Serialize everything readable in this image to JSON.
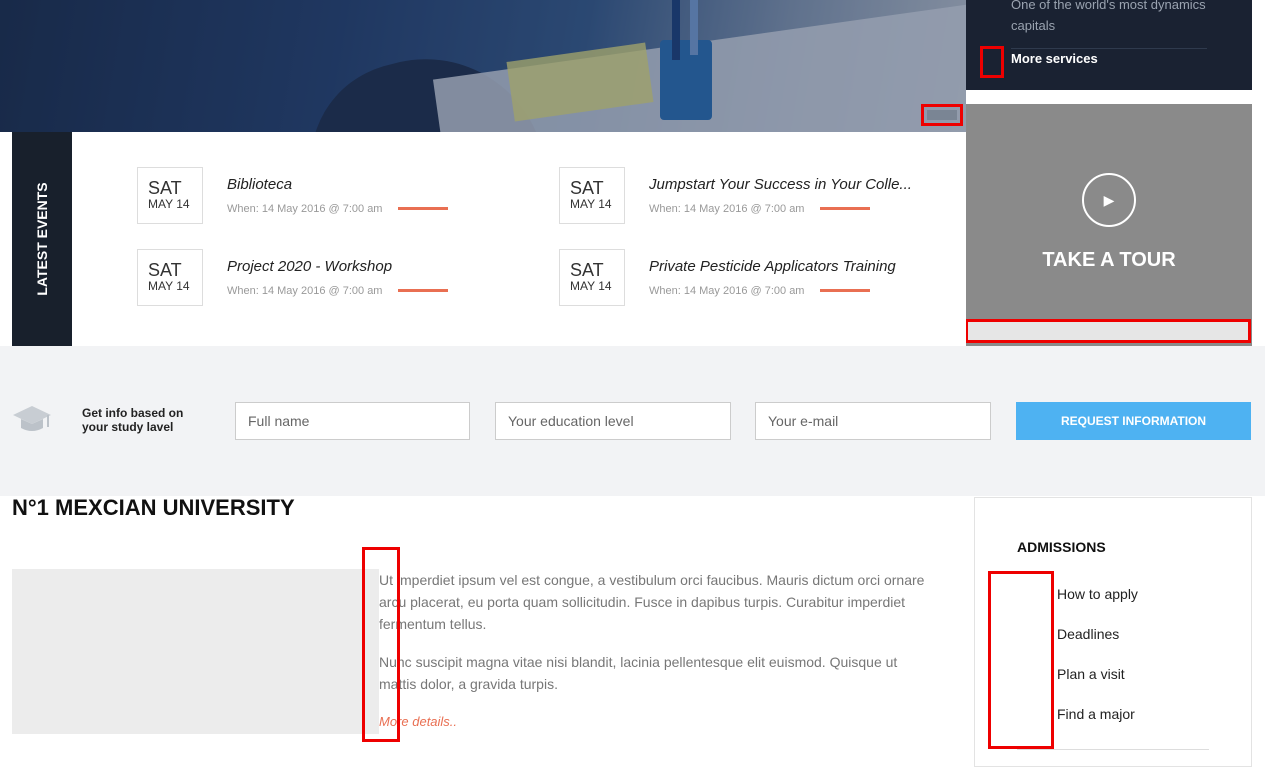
{
  "services": {
    "description": "One of the world's most dynamics capitals",
    "more_label": "More services"
  },
  "tour": {
    "title": "TAKE A TOUR",
    "play_icon": "play-icon"
  },
  "events": {
    "sidebar_title": "LATEST EVENTS",
    "items": [
      {
        "day": "SAT",
        "month": "MAY 14",
        "title": "Biblioteca",
        "when": "When: 14 May 2016 @ 7:00 am"
      },
      {
        "day": "SAT",
        "month": "MAY 14",
        "title": "Jumpstart Your Success in Your Colle...",
        "when": "When: 14 May 2016 @ 7:00 am"
      },
      {
        "day": "SAT",
        "month": "MAY 14",
        "title": "Project 2020 - Workshop",
        "when": "When: 14 May 2016 @ 7:00 am"
      },
      {
        "day": "SAT",
        "month": "MAY 14",
        "title": "Private Pesticide Applicators Training",
        "when": "When: 14 May 2016 @ 7:00 am"
      }
    ]
  },
  "info": {
    "text_line1": "Get info based on",
    "text_line2": "your study lavel",
    "full_name_placeholder": "Full name",
    "education_placeholder": "Your education level",
    "email_placeholder": "Your e-mail",
    "button_label": "REQUEST INFORMATION",
    "button_color": "#4eb2f2"
  },
  "main": {
    "title": "N°1 MEXCIAN UNIVERSITY",
    "paragraph1": "Ut imperdiet ipsum vel est congue, a vestibulum orci faucibus. Mauris dictum orci ornare arcu placerat, eu porta quam sollicitudin. Fusce in dapibus turpis. Curabitur imperdiet fermentum tellus.",
    "paragraph2": "Nunc suscipit magna vitae nisi blandit, lacinia pellentesque elit euismod. Quisque ut mattis dolor, a gravida turpis.",
    "more_details": "More details..",
    "accent_color": "#e96f52"
  },
  "admissions": {
    "title": "ADMISSIONS",
    "items": [
      "How to apply",
      "Deadlines",
      "Plan a visit",
      "Find a major"
    ]
  }
}
